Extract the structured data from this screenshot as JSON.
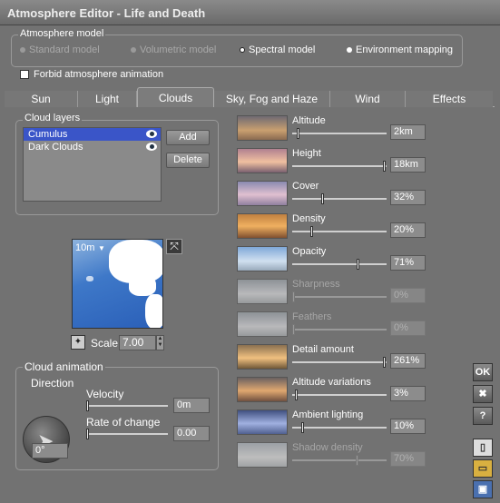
{
  "window": {
    "title": "Atmosphere Editor - Life and Death"
  },
  "model": {
    "group_label": "Atmosphere model",
    "options": [
      {
        "label": "Standard model",
        "enabled": false
      },
      {
        "label": "Volumetric model",
        "enabled": false
      },
      {
        "label": "Spectral model",
        "enabled": true,
        "selected": true
      },
      {
        "label": "Environment mapping",
        "enabled": true
      }
    ]
  },
  "forbid_animation": {
    "label": "Forbid atmosphere animation",
    "checked": false
  },
  "tabs": [
    "Sun",
    "Light",
    "Clouds",
    "Sky, Fog and Haze",
    "Wind",
    "Effects"
  ],
  "active_tab": "Clouds",
  "cloud_layers": {
    "label": "Cloud layers",
    "items": [
      "Cumulus",
      "Dark Clouds"
    ],
    "selected": "Cumulus",
    "add_label": "Add",
    "delete_label": "Delete"
  },
  "preview": {
    "size_label": "10m",
    "scale_label": "Scale",
    "scale_value": "7.00"
  },
  "animation": {
    "label": "Cloud animation",
    "direction_label": "Direction",
    "direction_value": "0°",
    "velocity_label": "Velocity",
    "velocity_value": "0m",
    "rate_label": "Rate of change",
    "rate_value": "0.00"
  },
  "params": [
    {
      "label": "Altitude",
      "value": "2km",
      "level": 0.05,
      "enabled": true
    },
    {
      "label": "Height",
      "value": "18km",
      "level": 1.0,
      "enabled": true
    },
    {
      "label": "Cover",
      "value": "32%",
      "level": 0.32,
      "enabled": true
    },
    {
      "label": "Density",
      "value": "20%",
      "level": 0.2,
      "enabled": true
    },
    {
      "label": "Opacity",
      "value": "71%",
      "level": 0.71,
      "enabled": true
    },
    {
      "label": "Sharpness",
      "value": "0%",
      "level": 0,
      "enabled": false
    },
    {
      "label": "Feathers",
      "value": "0%",
      "level": 0,
      "enabled": false
    },
    {
      "label": "Detail amount",
      "value": "261%",
      "level": 1.0,
      "enabled": true
    },
    {
      "label": "Altitude variations",
      "value": "3%",
      "level": 0.03,
      "enabled": true
    },
    {
      "label": "Ambient lighting",
      "value": "10%",
      "level": 0.1,
      "enabled": true
    },
    {
      "label": "Shadow density",
      "value": "70%",
      "level": 0.7,
      "enabled": false
    }
  ],
  "side_buttons": {
    "ok": "OK",
    "close": "✖",
    "help": "?"
  }
}
